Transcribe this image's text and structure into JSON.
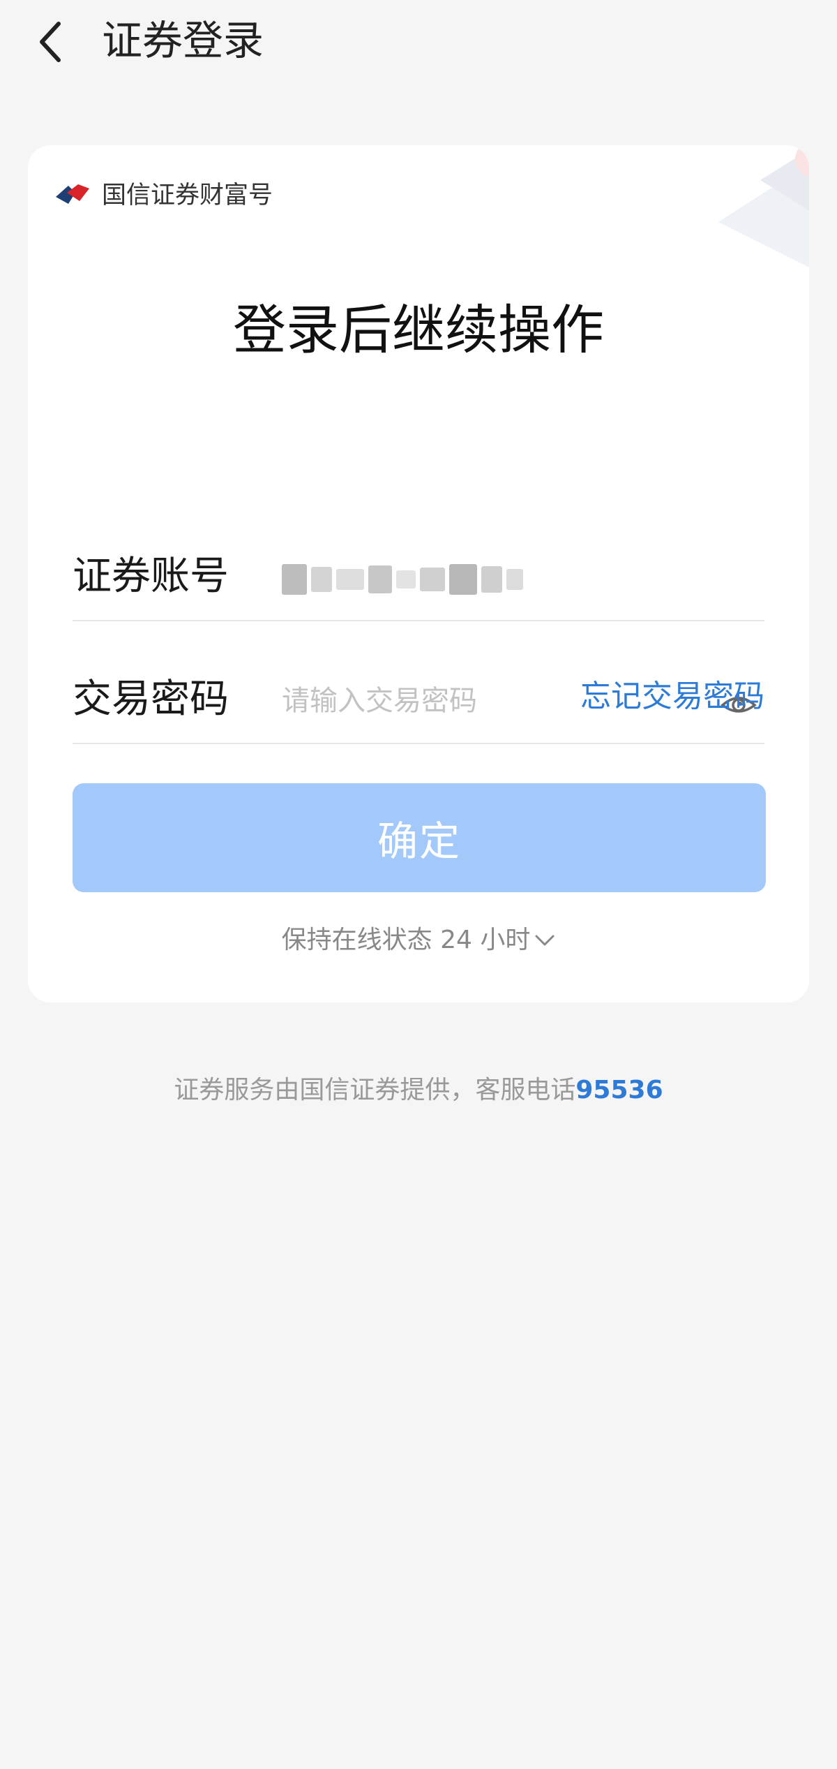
{
  "header": {
    "title": "证券登录"
  },
  "card": {
    "brand_name": "国信证券财富号",
    "heading": "登录后继续操作",
    "account": {
      "label": "证券账号"
    },
    "password": {
      "label": "交易密码",
      "placeholder": "请输入交易密码"
    },
    "forgot_label": "忘记交易密码",
    "confirm_label": "确定",
    "stay_online_label": "保持在线状态 24 小时"
  },
  "footer": {
    "text": "证券服务由国信证券提供，客服电话",
    "phone": "95536"
  },
  "colors": {
    "accent": "#2d7bd6",
    "button_disabled": "#a2c9fa",
    "background": "#f5f5f5"
  },
  "icons": {
    "back": "chevron-left-icon",
    "eye": "eye-icon",
    "expand": "chevron-down-icon"
  }
}
